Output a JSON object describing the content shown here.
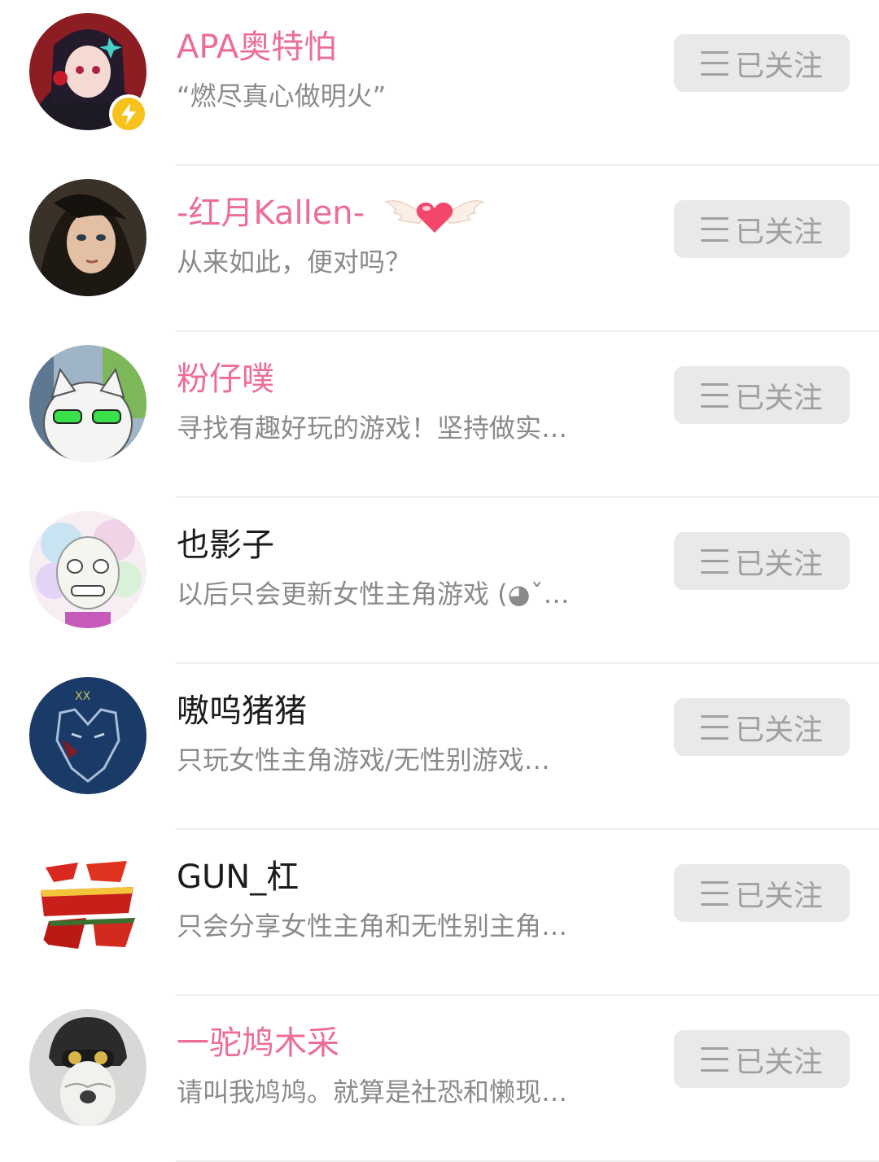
{
  "follow_label": "已关注",
  "users": [
    {
      "name": "APA奥特怕",
      "bio": "“燃尽真心做明火”",
      "name_color": "pink",
      "avatar": "anime-girl-red-avatar",
      "badge": "lightning-icon"
    },
    {
      "name": "-红月Kallen-",
      "bio": "从来如此，便对吗？",
      "name_color": "pink",
      "avatar": "dark-hair-girl-avatar",
      "decoration": "winged-heart-icon"
    },
    {
      "name": "粉仔噗",
      "bio": "寻找有趣好玩的游戏！坚持做实…",
      "name_color": "pink",
      "avatar": "cat-with-glasses-avatar"
    },
    {
      "name": "也影子",
      "bio": "以后只会更新女性主角游戏 (◕ˇ…",
      "name_color": "black",
      "avatar": "pastel-skull-avatar"
    },
    {
      "name": "嗷呜猪猪",
      "bio": "只玩女性主角游戏/无性别游戏…",
      "name_color": "black",
      "avatar": "wolf-emblem-avatar"
    },
    {
      "name": "GUN_杠",
      "bio": "只会分享女性主角和无性别主角…",
      "name_color": "black",
      "avatar": "red-calligraphy-avatar"
    },
    {
      "name": "一驼鸠木采",
      "bio": "请叫我鸠鸠。就算是社恐和懒现…",
      "name_color": "pink",
      "avatar": "alpaca-helmet-avatar"
    }
  ]
}
